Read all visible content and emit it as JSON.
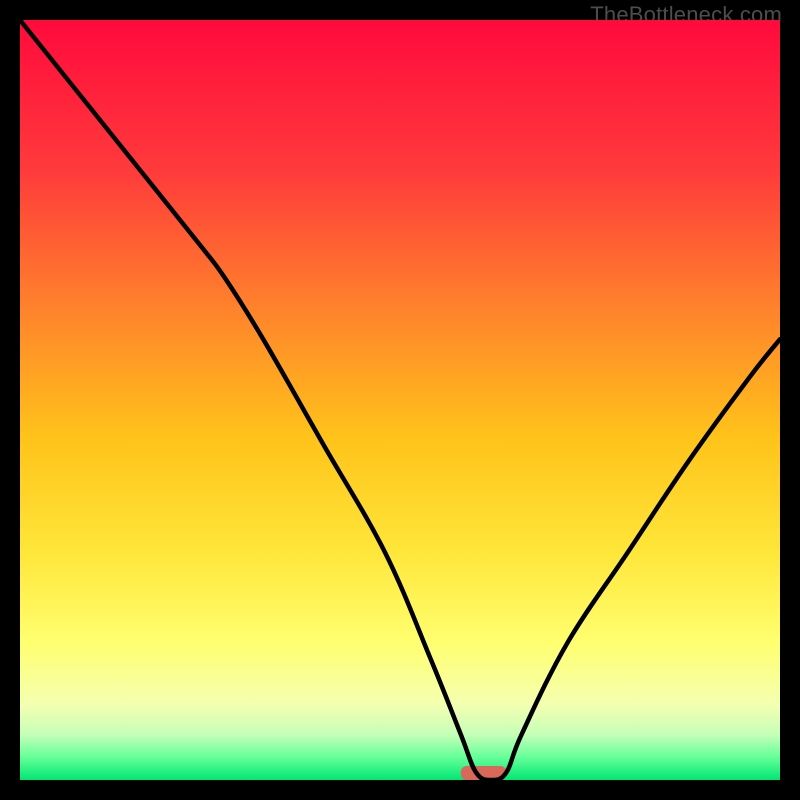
{
  "watermark": "TheBottleneck.com",
  "chart_data": {
    "type": "line",
    "title": "",
    "xlabel": "",
    "ylabel": "",
    "xlim": [
      0,
      100
    ],
    "ylim": [
      0,
      100
    ],
    "series": [
      {
        "name": "bottleneck-curve",
        "x": [
          0,
          8,
          16,
          24,
          27,
          32,
          40,
          48,
          54,
          58,
          60,
          62,
          64,
          66,
          72,
          80,
          88,
          96,
          100
        ],
        "y": [
          100,
          90,
          80,
          70,
          66,
          58,
          44,
          30,
          16,
          6,
          1,
          0,
          1,
          6,
          18,
          30,
          42,
          53,
          58
        ]
      }
    ],
    "marker": {
      "name": "optimal-range",
      "x_center": 61,
      "width": 6,
      "color": "#d9685b"
    },
    "gradient_stops": [
      {
        "y": 0,
        "color": "#ff0a3c"
      },
      {
        "y": 20,
        "color": "#ff3b3b"
      },
      {
        "y": 40,
        "color": "#ff8a2a"
      },
      {
        "y": 55,
        "color": "#ffc31a"
      },
      {
        "y": 70,
        "color": "#ffe63a"
      },
      {
        "y": 82,
        "color": "#ffff70"
      },
      {
        "y": 90,
        "color": "#f4ffb0"
      },
      {
        "y": 94,
        "color": "#c6ffb8"
      },
      {
        "y": 97,
        "color": "#66ff99"
      },
      {
        "y": 100,
        "color": "#00e672"
      }
    ]
  }
}
